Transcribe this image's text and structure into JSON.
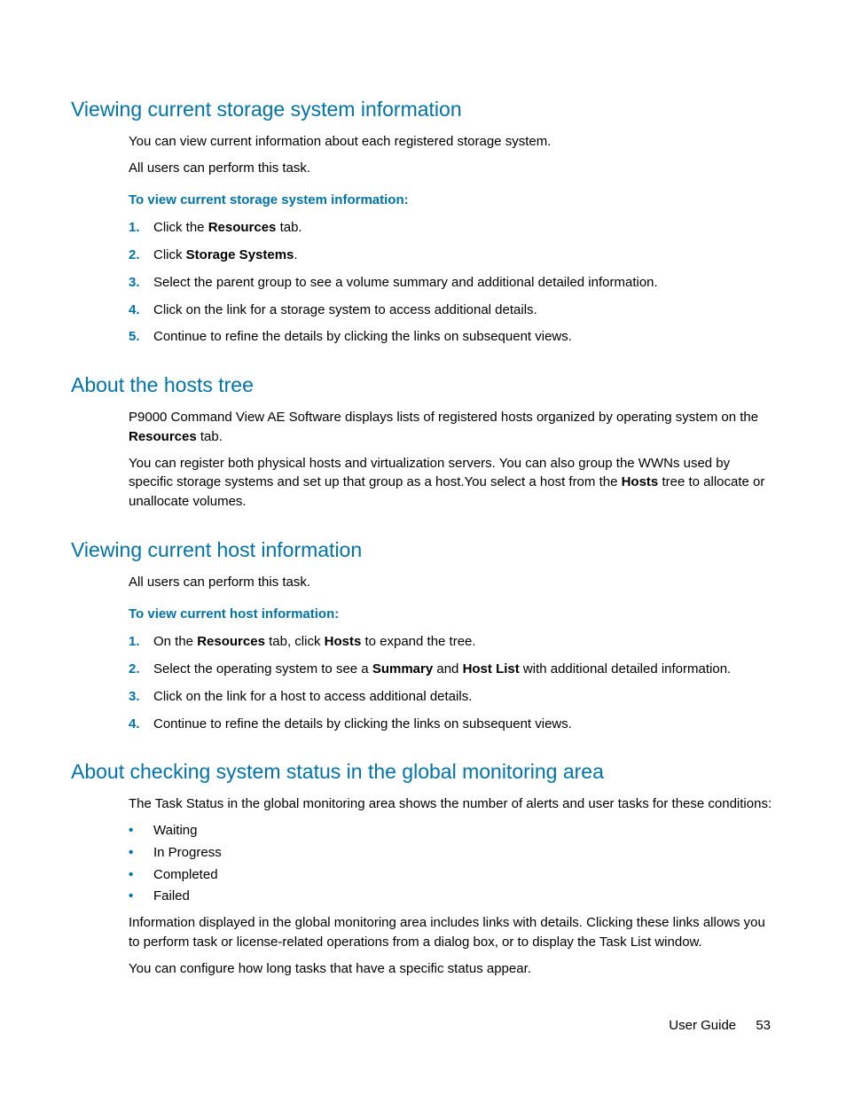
{
  "section1": {
    "heading": "Viewing current storage system information",
    "p1": "You can view current information about each registered storage system.",
    "p2": "All users can perform this task.",
    "sub": "To view current storage system information:",
    "steps": [
      {
        "pre": "Click the ",
        "bold": "Resources",
        "post": " tab."
      },
      {
        "pre": "Click ",
        "bold": "Storage Systems",
        "post": "."
      },
      {
        "pre": "Select the parent group to see a volume summary and additional detailed information.",
        "bold": "",
        "post": ""
      },
      {
        "pre": "Click on the link for a storage system to access additional details.",
        "bold": "",
        "post": ""
      },
      {
        "pre": "Continue to refine the details by clicking the links on subsequent views.",
        "bold": "",
        "post": ""
      }
    ]
  },
  "section2": {
    "heading": "About the hosts tree",
    "p1_pre": "P9000 Command View AE Software displays lists of registered hosts organized by operating system on the ",
    "p1_b": "Resources",
    "p1_post": " tab.",
    "p2_pre": "You can register both physical hosts and virtualization servers. You can also group the WWNs used by specific storage systems and set up that group as a host.You select a host from the ",
    "p2_b": "Hosts",
    "p2_post": " tree to allocate or unallocate volumes."
  },
  "section3": {
    "heading": "Viewing current host information",
    "p1": "All users can perform this task.",
    "sub": "To view current host information:",
    "steps": [
      {
        "parts": [
          {
            "t": "On the "
          },
          {
            "b": "Resources"
          },
          {
            "t": " tab, click "
          },
          {
            "b": "Hosts"
          },
          {
            "t": " to expand the tree."
          }
        ]
      },
      {
        "parts": [
          {
            "t": "Select the operating system to see a "
          },
          {
            "b": "Summary"
          },
          {
            "t": " and "
          },
          {
            "b": "Host List"
          },
          {
            "t": " with additional detailed information."
          }
        ]
      },
      {
        "parts": [
          {
            "t": "Click on the link for a host to access additional details."
          }
        ]
      },
      {
        "parts": [
          {
            "t": "Continue to refine the details by clicking the links on subsequent views."
          }
        ]
      }
    ]
  },
  "section4": {
    "heading": "About checking system status in the global monitoring area",
    "p1": "The Task Status in the global monitoring area shows the number of alerts and user tasks for these conditions:",
    "bullets": [
      "Waiting",
      "In Progress",
      "Completed",
      "Failed"
    ],
    "p2": "Information displayed in the global monitoring area includes links with details. Clicking these links allows you to perform task or license-related operations from a dialog box, or to display the Task List window.",
    "p3": "You can configure how long tasks that have a specific status appear."
  },
  "footer": {
    "label": "User Guide",
    "page": "53"
  }
}
